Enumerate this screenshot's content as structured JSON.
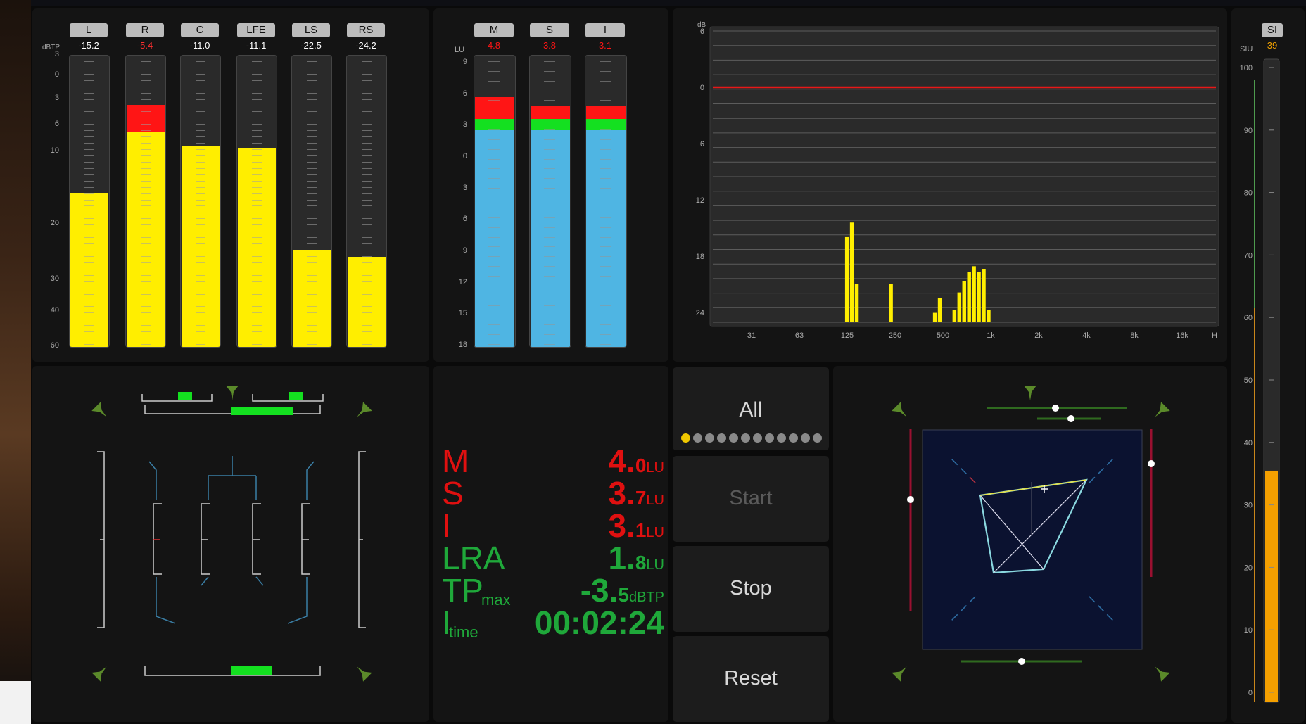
{
  "true_peak": {
    "unit": "dBTP",
    "scale_ticks": [
      "3",
      "0",
      "3",
      "6",
      "10",
      "20",
      "30",
      "40",
      "60"
    ],
    "channels": [
      {
        "label": "L",
        "value": "-15.2",
        "value_color": "#ffffff",
        "level": 0.53,
        "peak": 0
      },
      {
        "label": "R",
        "value": "-5.4",
        "value_color": "#ff3030",
        "level": 0.74,
        "peak": 0.09
      },
      {
        "label": "C",
        "value": "-11.0",
        "value_color": "#ffffff",
        "level": 0.69,
        "peak": 0
      },
      {
        "label": "LFE",
        "value": "-11.1",
        "value_color": "#ffffff",
        "level": 0.68,
        "peak": 0
      },
      {
        "label": "LS",
        "value": "-22.5",
        "value_color": "#ffffff",
        "level": 0.33,
        "peak": 0
      },
      {
        "label": "RS",
        "value": "-24.2",
        "value_color": "#ffffff",
        "level": 0.31,
        "peak": 0
      }
    ]
  },
  "loudness": {
    "unit": "LU",
    "scale_ticks": [
      "9",
      "6",
      "3",
      "0",
      "3",
      "6",
      "9",
      "12",
      "15",
      "18"
    ],
    "meters": [
      {
        "label": "M",
        "value": "4.8",
        "level": 0.81
      },
      {
        "label": "S",
        "value": "3.8",
        "level": 0.8
      },
      {
        "label": "I",
        "value": "3.1",
        "level": 0.78
      }
    ]
  },
  "spectrum": {
    "unit": "dB",
    "y_ticks": [
      "6",
      "0",
      "6",
      "12",
      "18",
      "24"
    ],
    "x_ticks": [
      "31",
      "63",
      "125",
      "250",
      "500",
      "1k",
      "2k",
      "4k",
      "8k",
      "16k",
      "H"
    ],
    "ref_line": 0,
    "bars": [
      0,
      0,
      0,
      0,
      0,
      0,
      0,
      0,
      0,
      0,
      0,
      0,
      0,
      0,
      0,
      0,
      0,
      0,
      0,
      0,
      0,
      0,
      0,
      0,
      0,
      0,
      0,
      0.29,
      0.34,
      0.13,
      0,
      0,
      0,
      0,
      0,
      0,
      0.13,
      0,
      0,
      0,
      0,
      0,
      0,
      0,
      0,
      0.03,
      0.08,
      0,
      0,
      0.04,
      0.1,
      0.14,
      0.17,
      0.19,
      0.17,
      0.18,
      0.04,
      0,
      0,
      0,
      0,
      0,
      0,
      0,
      0,
      0,
      0,
      0,
      0,
      0,
      0,
      0,
      0,
      0,
      0,
      0,
      0,
      0,
      0,
      0,
      0,
      0,
      0,
      0,
      0,
      0,
      0,
      0,
      0,
      0,
      0,
      0,
      0,
      0,
      0,
      0,
      0,
      0,
      0,
      0,
      0,
      0,
      0
    ]
  },
  "siu": {
    "label": "SI",
    "value": "39",
    "unit": "SIU",
    "scale_ticks": [
      "100",
      "90",
      "80",
      "70",
      "60",
      "50",
      "40",
      "30",
      "20",
      "10",
      "0"
    ],
    "level": 0.36
  },
  "readout": {
    "rows": [
      {
        "name": "M",
        "sub": "",
        "value": "4.",
        "frac": "0",
        "unit": "LU",
        "color": "#e01010"
      },
      {
        "name": "S",
        "sub": "",
        "value": "3.",
        "frac": "7",
        "unit": "LU",
        "color": "#e01010"
      },
      {
        "name": "I",
        "sub": "",
        "value": "3.",
        "frac": "1",
        "unit": "LU",
        "color": "#e01010"
      },
      {
        "name": "LRA",
        "sub": "",
        "value": "1.",
        "frac": "8",
        "unit": "LU",
        "color": "#1fa83a"
      },
      {
        "name": "TP",
        "sub": "max",
        "value": "-3.",
        "frac": "5",
        "unit": "dBTP",
        "color": "#1fa83a"
      },
      {
        "name": "I",
        "sub": "time",
        "value": "00:02:24",
        "frac": "",
        "unit": "",
        "color": "#1fa83a"
      }
    ]
  },
  "controls": {
    "all_label": "All",
    "start_label": "Start",
    "stop_label": "Stop",
    "reset_label": "Reset",
    "dots_total": 12,
    "dots_active": 1
  },
  "colors": {
    "yellow": "#ffee00",
    "red": "#ff1515",
    "green": "#14e020",
    "blue": "#4fb5e3",
    "orange": "#f5a000",
    "accent_green": "#5b8a2a"
  }
}
